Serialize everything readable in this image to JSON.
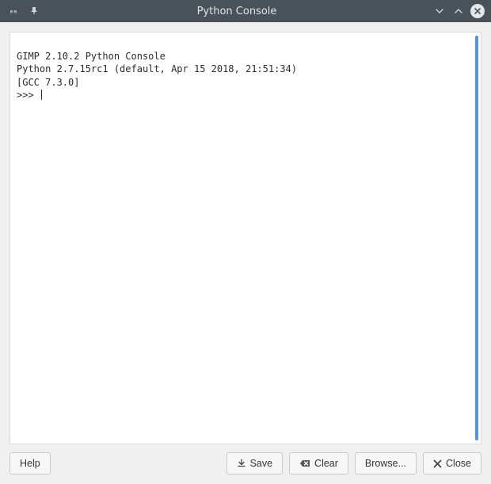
{
  "window": {
    "title": "Python Console"
  },
  "console": {
    "line1": "GIMP 2.10.2 Python Console",
    "line2": "Python 2.7.15rc1 (default, Apr 15 2018, 21:51:34)",
    "line3": "[GCC 7.3.0]",
    "prompt": ">>> "
  },
  "buttons": {
    "help": "Help",
    "save": "Save",
    "clear": "Clear",
    "browse": "Browse...",
    "close": "Close"
  }
}
